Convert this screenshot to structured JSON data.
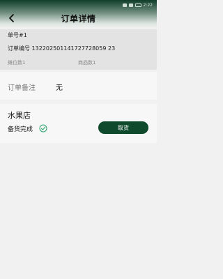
{
  "status": {
    "time": "2:22"
  },
  "header": {
    "title": "订单详情"
  },
  "order": {
    "number_label": "单号#1",
    "code_label": "订单编号",
    "code_value": "132202501141727728059 23",
    "stall_label": "摊位数1",
    "goods_label": "商品数1"
  },
  "remark": {
    "label": "订单备注",
    "value": "无"
  },
  "store": {
    "name": "水果店",
    "status": "备货完成",
    "button_label": "取货"
  },
  "colors": {
    "accent": "#0e4a2b",
    "check": "#2aa36b"
  }
}
